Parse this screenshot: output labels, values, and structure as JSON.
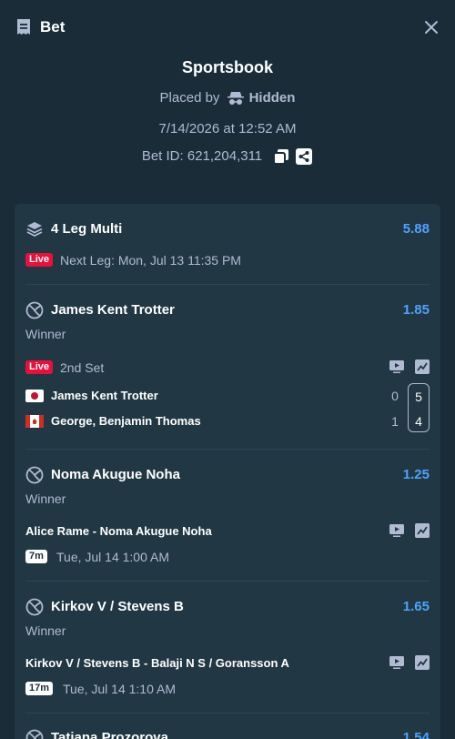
{
  "header": {
    "title": "Bet"
  },
  "summary": {
    "title": "Sportsbook",
    "placed_by_label": "Placed by",
    "placed_by_user": "Hidden",
    "datetime": "7/14/2026 at 12:52 AM",
    "bet_id": "Bet ID: 621,204,311"
  },
  "multi": {
    "title": "4 Leg Multi",
    "odds": "5.88",
    "live_badge": "Live",
    "next_leg": "Next Leg: Mon, Jul 13 11:35 PM"
  },
  "legs": [
    {
      "title": "James Kent Trotter",
      "odds": "1.85",
      "market": "Winner",
      "live_badge": "Live",
      "status": "2nd Set",
      "players": [
        {
          "name": "James Kent Trotter",
          "flag": "japan",
          "set1": "0",
          "current": "5"
        },
        {
          "name": "George, Benjamin Thomas",
          "flag": "canada",
          "set1": "1",
          "current": "4"
        }
      ]
    },
    {
      "title": "Noma Akugue Noha",
      "odds": "1.25",
      "market": "Winner",
      "match": "Alice Rame - Noma Akugue Noha",
      "countdown": "7m",
      "start": "Tue, Jul 14  1:00 AM"
    },
    {
      "title": "Kirkov V / Stevens B",
      "odds": "1.65",
      "market": "Winner",
      "match": "Kirkov V / Stevens B - Balaji N S / Goransson A",
      "countdown": "17m",
      "start": "Tue, Jul 14  1:10 AM"
    },
    {
      "title": "Tatiana Prozorova",
      "odds": "1.54"
    }
  ],
  "colors": {
    "background": "#1a2c38",
    "card": "#213743",
    "odds": "#4da3ff",
    "live": "#e9113c"
  }
}
